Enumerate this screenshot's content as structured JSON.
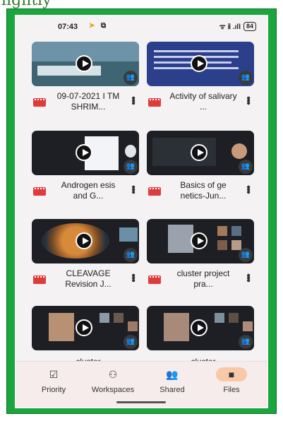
{
  "page_top_text": "lightly",
  "status_bar": {
    "time": "07:43",
    "icon_a": "notification-icon",
    "icon_b": "cast-icon",
    "signal_text": "ᯤ ⅱ .ıll",
    "battery": "84"
  },
  "files": [
    {
      "title": "09-07-2021 I TM SHRIM...",
      "thumb": "shrimp farm photo"
    },
    {
      "title": "Activity of salivary ...",
      "thumb": "blue slide"
    },
    {
      "title": "Androgen esis and G...",
      "thumb": "video meeting"
    },
    {
      "title": "Basics of ge netics-Jun...",
      "thumb": "video meeting"
    },
    {
      "title": "CLEAVAGE Revision J...",
      "thumb": "embryo image"
    },
    {
      "title": "cluster project pra...",
      "thumb": "video meeting"
    },
    {
      "title": "cluster",
      "thumb": "video meeting"
    },
    {
      "title": "cluster",
      "thumb": "video meeting"
    }
  ],
  "nav": [
    {
      "label": "Priority",
      "icon": "check-circle-icon"
    },
    {
      "label": "Workspaces",
      "icon": "workspaces-icon"
    },
    {
      "label": "Shared",
      "icon": "shared-people-icon"
    },
    {
      "label": "Files",
      "icon": "folder-icon"
    }
  ],
  "colors": {
    "frame_green": "#1aa63c",
    "video_red": "#e03b3b",
    "nav_active": "#f8c9a9"
  }
}
